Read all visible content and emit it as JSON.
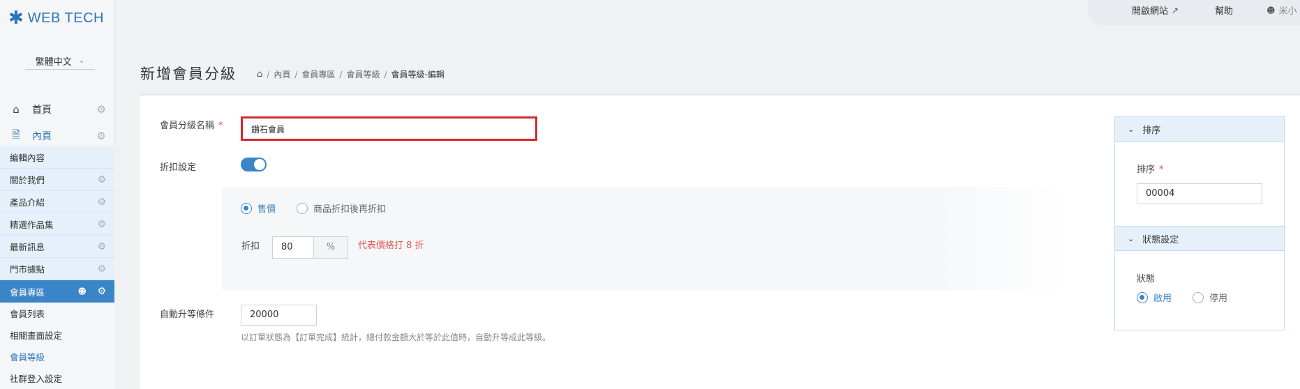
{
  "brand": {
    "logo_mark": "✱",
    "name": "WEB TECH"
  },
  "language": {
    "selected": "繁體中文",
    "icon": "chevron-down-icon"
  },
  "nav": {
    "home": {
      "label": "首頁",
      "icon": "home-icon"
    },
    "inner": {
      "label": "內頁",
      "icon": "document-icon"
    }
  },
  "sidebar_sub": [
    {
      "label": "編輯內容"
    },
    {
      "label": "關於我們"
    },
    {
      "label": "產品介紹"
    },
    {
      "label": "精選作品集"
    },
    {
      "label": "最新訊息"
    },
    {
      "label": "門市據點"
    },
    {
      "label": "會員專區"
    }
  ],
  "member_sub": [
    {
      "label": "會員列表"
    },
    {
      "label": "相關畫面設定"
    },
    {
      "label": "會員等級"
    },
    {
      "label": "社群登入設定"
    }
  ],
  "topbar": {
    "open_site": "開啟網站",
    "help": "幫助",
    "user": "米小"
  },
  "page": {
    "title": "新增會員分級"
  },
  "breadcrumb": [
    "內頁",
    "會員專區",
    "會員等級",
    "會員等級-編輯"
  ],
  "form": {
    "name_label": "會員分級名稱",
    "required_mark": "*",
    "name_value": "鑽石會員",
    "discount_label": "折扣設定",
    "discount_enabled": true,
    "radio_price": "售價",
    "radio_after": "商品折扣後再折扣",
    "discount_field_label": "折扣",
    "discount_value": "80",
    "discount_unit": "%",
    "discount_hint": "代表價格打 8 折",
    "upgrade_label": "自動升等條件",
    "upgrade_value": "20000",
    "upgrade_hint": "以訂單狀態為【訂單完成】統計，總付款金額大於等於此值時，自動升等成此等級。"
  },
  "right": {
    "sort_header": "排序",
    "sort_label": "排序",
    "sort_value": "00004",
    "status_header": "狀態設定",
    "status_label": "狀態",
    "status_on": "啟用",
    "status_off": "停用"
  },
  "colors": {
    "accent": "#3a85c7",
    "error": "#d12a30",
    "hint_red": "#e05a4f"
  }
}
